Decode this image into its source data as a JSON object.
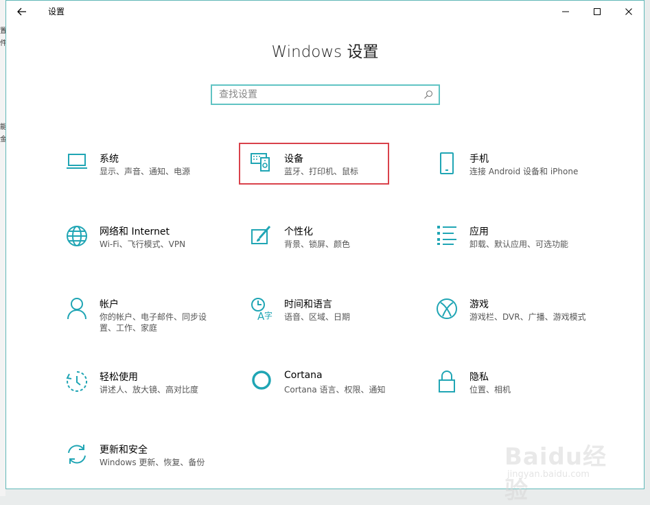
{
  "window": {
    "title": "设置"
  },
  "heading": "Windows 设置",
  "search": {
    "placeholder": "查找设置"
  },
  "background_fragments": [
    "置",
    "件",
    "能",
    "金"
  ],
  "accent_color": "#1fa5b4",
  "highlight_color": "#d9414a",
  "tiles": [
    {
      "id": "system",
      "icon": "laptop-icon",
      "label": "系统",
      "sub": "显示、声音、通知、电源"
    },
    {
      "id": "devices",
      "icon": "keyboard-speaker-icon",
      "label": "设备",
      "sub": "蓝牙、打印机、鼠标"
    },
    {
      "id": "phone",
      "icon": "phone-icon",
      "label": "手机",
      "sub": "连接 Android 设备和 iPhone"
    },
    {
      "id": "network",
      "icon": "globe-icon",
      "label": "网络和 Internet",
      "sub": "Wi-Fi、飞行模式、VPN"
    },
    {
      "id": "personalization",
      "icon": "paint-icon",
      "label": "个性化",
      "sub": "背景、锁屏、颜色"
    },
    {
      "id": "apps",
      "icon": "apps-list-icon",
      "label": "应用",
      "sub": "卸载、默认应用、可选功能"
    },
    {
      "id": "accounts",
      "icon": "person-icon",
      "label": "帐户",
      "sub": "你的帐户、电子邮件、同步设置、工作、家庭"
    },
    {
      "id": "time_language",
      "icon": "time-language-icon",
      "label": "时间和语言",
      "sub": "语音、区域、日期"
    },
    {
      "id": "gaming",
      "icon": "xbox-icon",
      "label": "游戏",
      "sub": "游戏栏、DVR、广播、游戏模式"
    },
    {
      "id": "ease_of_access",
      "icon": "ease-of-access-icon",
      "label": "轻松使用",
      "sub": "讲述人、放大镜、高对比度"
    },
    {
      "id": "cortana",
      "icon": "cortana-icon",
      "label": "Cortana",
      "sub": "Cortana 语言、权限、通知"
    },
    {
      "id": "privacy",
      "icon": "lock-icon",
      "label": "隐私",
      "sub": "位置、相机"
    },
    {
      "id": "update_security",
      "icon": "sync-icon",
      "label": "更新和安全",
      "sub": "Windows 更新、恢复、备份"
    }
  ],
  "watermark": {
    "brand": "Baidu经验",
    "url": "jingyan.baidu.com"
  }
}
